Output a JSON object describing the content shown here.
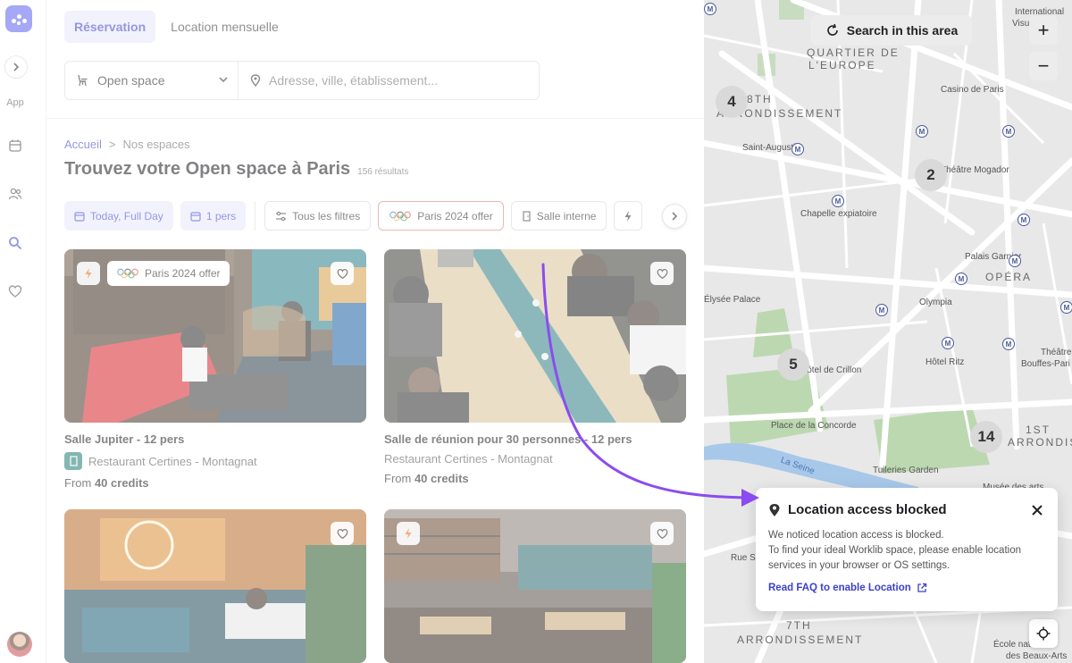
{
  "rail": {
    "app_label": "App"
  },
  "tabs": [
    {
      "label": "Réservation",
      "active": true
    },
    {
      "label": "Location mensuelle",
      "active": false
    }
  ],
  "search": {
    "type_value": "Open space",
    "address_placeholder": "Adresse, ville, établissement..."
  },
  "breadcrumb": {
    "home": "Accueil",
    "separator": ">",
    "current": "Nos espaces"
  },
  "page": {
    "title": "Trouvez votre Open space à Paris",
    "results": "156 résultats"
  },
  "filters": {
    "date": "Today, Full Day",
    "people": "1 pers",
    "all_filters": "Tous les filtres",
    "olympic": "Paris 2024 offer",
    "room": "Salle interne"
  },
  "cards": [
    {
      "name": "Salle Jupiter - 12 pers",
      "venue": "Restaurant Certines - Montagnat",
      "price_prefix": "From ",
      "price": "40 credits",
      "badge_offer": "Paris 2024 offer"
    },
    {
      "name": "Salle de réunion pour 30 personnes - 12 pers",
      "venue": "Restaurant Certines - Montagnat",
      "price_prefix": "From ",
      "price": "40 credits"
    }
  ],
  "map": {
    "search_area_label": "Search in this area",
    "zoom_in": "+",
    "zoom_out": "−",
    "clusters": [
      "4",
      "2",
      "5",
      "14"
    ],
    "districts": [
      "QUARTIER DE",
      "L'EUROPE",
      "8TH",
      "ARRONDISSEMENT",
      "OPÉRA",
      "1ST",
      "ARRONDISSEMENT",
      "7TH",
      "ARRONDISSEMENT"
    ],
    "places": [
      "International",
      "Visual Th",
      "Casino de Paris",
      "Saint-Augustin",
      "Théâtre Mogador",
      "Chapelle expiatoire",
      "Palais Garnier",
      "Olympia",
      "Élysée Palace",
      "Hôtel de Crillon",
      "Hôtel Ritz",
      "Théâtre des",
      "Bouffes-Pari",
      "Place de la Concorde",
      "Tuileries Garden",
      "Musée des arts",
      "La Seine",
      "Rue S",
      "École nationale",
      "des Beaux-Arts"
    ]
  },
  "popup": {
    "title": "Location access blocked",
    "body_line1": "We noticed location access is blocked.",
    "body_line2": "To find your ideal Worklib space, please enable location services in your browser or OS settings.",
    "link": "Read FAQ to enable Location"
  },
  "colors": {
    "accent": "#3d40c8",
    "accent_bg": "#e7e8fb",
    "arrow": "#8a4cf0",
    "logo": "#5b5ff0"
  }
}
